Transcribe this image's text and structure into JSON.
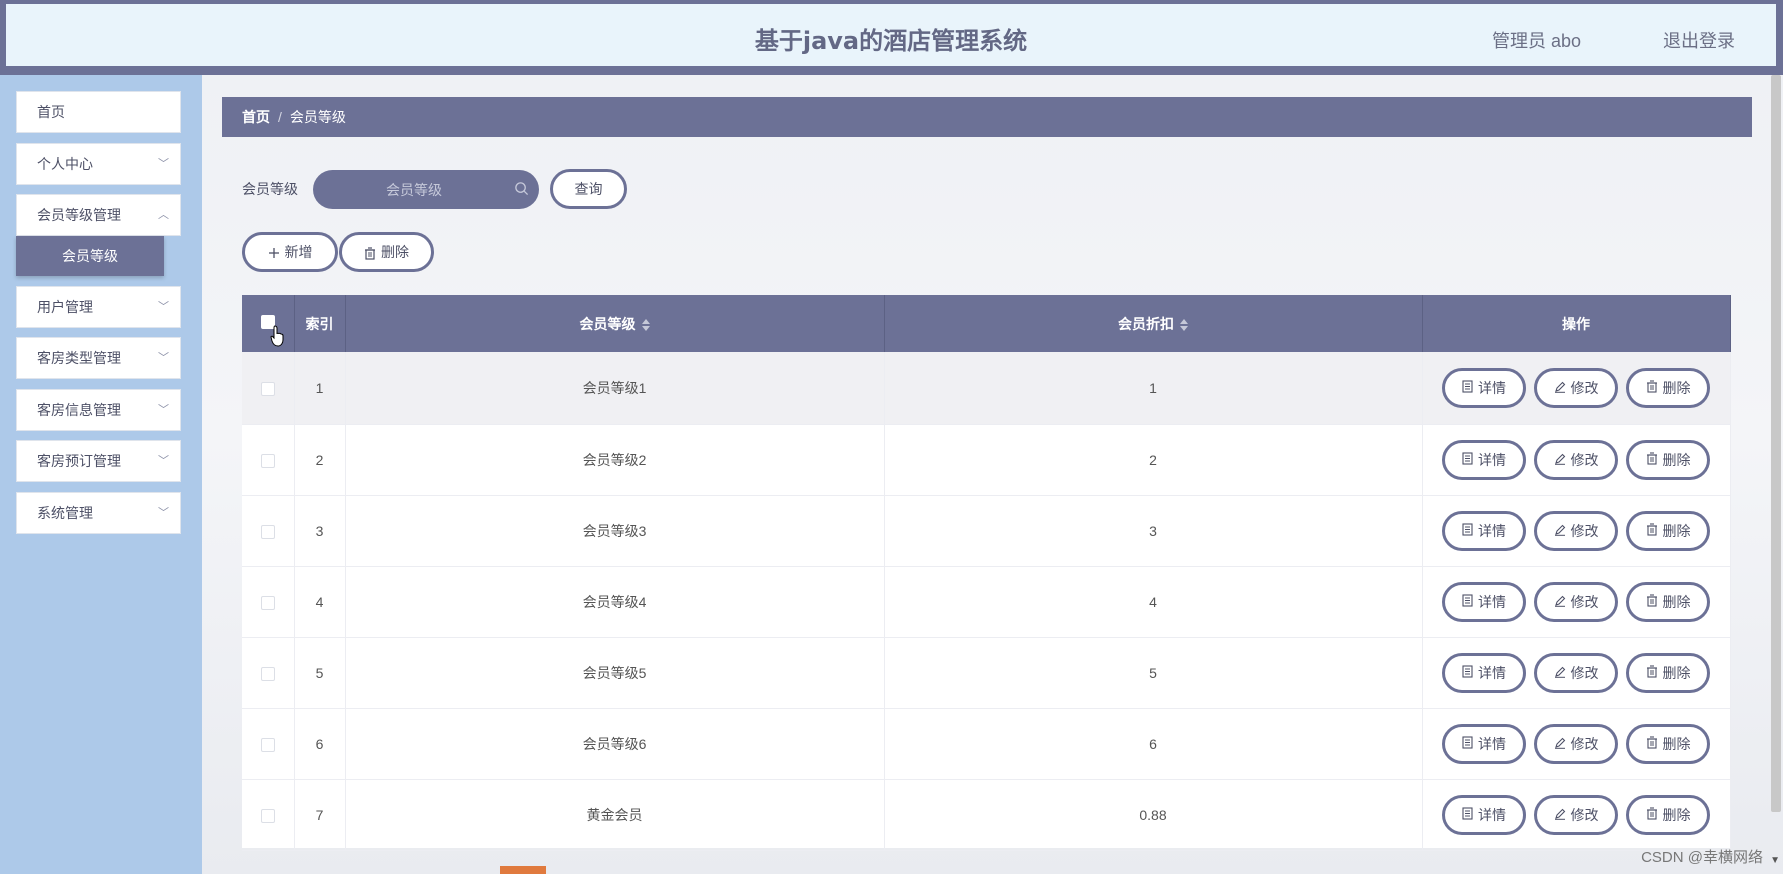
{
  "header": {
    "title": "基于java的酒店管理系统",
    "user_label": "管理员 abo",
    "logout_label": "退出登录"
  },
  "sidebar": {
    "items": [
      {
        "label": "首页"
      },
      {
        "label": "个人中心"
      },
      {
        "label": "会员等级管理"
      },
      {
        "label": "用户管理"
      },
      {
        "label": "客房类型管理"
      },
      {
        "label": "客房信息管理"
      },
      {
        "label": "客房预订管理"
      },
      {
        "label": "系统管理"
      }
    ],
    "active_sub": "会员等级"
  },
  "breadcrumb": {
    "home": "首页",
    "separator": "/",
    "current": "会员等级"
  },
  "search": {
    "label": "会员等级",
    "placeholder": "会员等级",
    "query_button": "查询"
  },
  "actions": {
    "add_label": "新增",
    "delete_label": "删除"
  },
  "table": {
    "headers": {
      "index": "索引",
      "level": "会员等级",
      "discount": "会员折扣",
      "ops": "操作"
    },
    "rows": [
      {
        "index": "1",
        "level": "会员等级1",
        "discount": "1"
      },
      {
        "index": "2",
        "level": "会员等级2",
        "discount": "2"
      },
      {
        "index": "3",
        "level": "会员等级3",
        "discount": "3"
      },
      {
        "index": "4",
        "level": "会员等级4",
        "discount": "4"
      },
      {
        "index": "5",
        "level": "会员等级5",
        "discount": "5"
      },
      {
        "index": "6",
        "level": "会员等级6",
        "discount": "6"
      },
      {
        "index": "7",
        "level": "黄金会员",
        "discount": "0.88"
      }
    ],
    "row_actions": {
      "detail": "详情",
      "edit": "修改",
      "delete": "删除"
    }
  },
  "watermark": "CSDN @幸横网络",
  "colors": {
    "primary": "#6c7196",
    "sidebar_bg": "#adc9e9",
    "header_bg": "#e9f4fb"
  }
}
